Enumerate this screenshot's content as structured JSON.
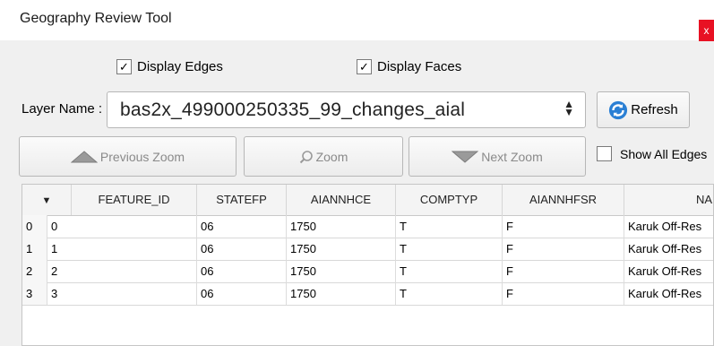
{
  "window": {
    "title": "Geography Review Tool",
    "close_label": "x"
  },
  "options": {
    "display_edges": {
      "label": "Display Edges",
      "checked": true
    },
    "display_faces": {
      "label": "Display Faces",
      "checked": true
    }
  },
  "layer": {
    "label": "Layer Name :",
    "value": "bas2x_499000250335_99_changes_aial"
  },
  "buttons": {
    "refresh": "Refresh",
    "previous_zoom": "Previous Zoom",
    "zoom": "Zoom",
    "next_zoom": "Next Zoom",
    "show_all_edges": "Show All Edges"
  },
  "table": {
    "columns": [
      "",
      "FEATURE_ID",
      "STATEFP",
      "AIANNHCE",
      "COMPTYP",
      "AIANNHFSR",
      "NA"
    ],
    "rows": [
      [
        "0",
        "0",
        "06",
        "1750",
        "T",
        "F",
        "Karuk Off-Res"
      ],
      [
        "1",
        "1",
        "06",
        "1750",
        "T",
        "F",
        "Karuk Off-Res"
      ],
      [
        "2",
        "2",
        "06",
        "1750",
        "T",
        "F",
        "Karuk Off-Res"
      ],
      [
        "3",
        "3",
        "06",
        "1750",
        "T",
        "F",
        "Karuk Off-Res"
      ]
    ]
  },
  "colors": {
    "close": "#e81123",
    "refresh_icon": "#2a7fd4"
  }
}
